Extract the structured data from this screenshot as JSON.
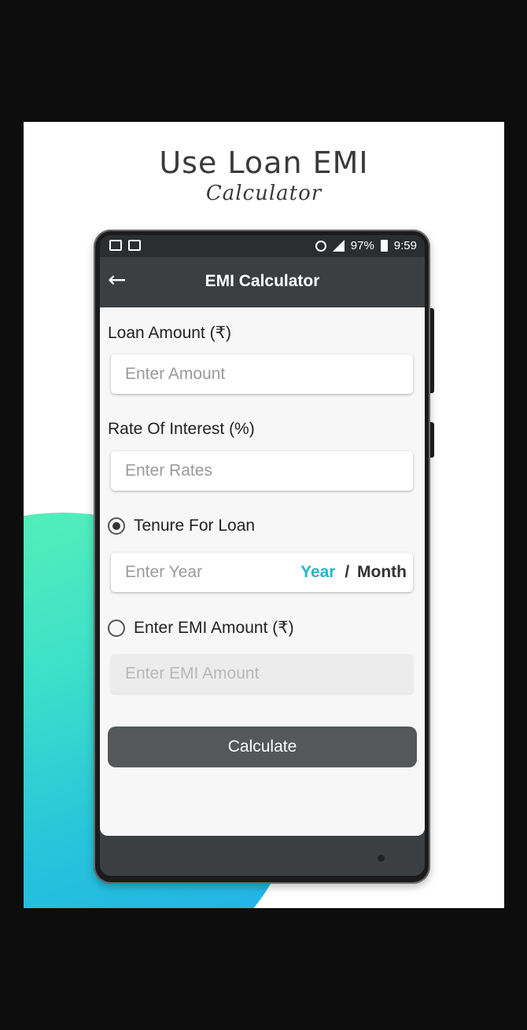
{
  "promo": {
    "title": "Use Loan EMI",
    "subtitle": "Calculator"
  },
  "status_bar": {
    "battery": "97%",
    "time": "9:59"
  },
  "app_bar": {
    "title": "EMI Calculator"
  },
  "form": {
    "loan_amount": {
      "label": "Loan Amount (₹)",
      "placeholder": "Enter Amount",
      "value": ""
    },
    "interest": {
      "label": "Rate Of Interest (%)",
      "placeholder": "Enter Rates",
      "value": ""
    },
    "tenure": {
      "label": "Tenure For Loan",
      "selected": true,
      "placeholder": "Enter Year",
      "value": "",
      "unit_year": "Year",
      "unit_separator": "/",
      "unit_month": "Month",
      "active_unit": "Year"
    },
    "emi_amount": {
      "label": "Enter EMI Amount (₹)",
      "selected": false,
      "placeholder": "Enter EMI Amount",
      "value": ""
    },
    "calculate_label": "Calculate"
  },
  "colors": {
    "accent": "#1fb8c9",
    "app_bar": "#3c3f42",
    "button": "#54585b"
  }
}
